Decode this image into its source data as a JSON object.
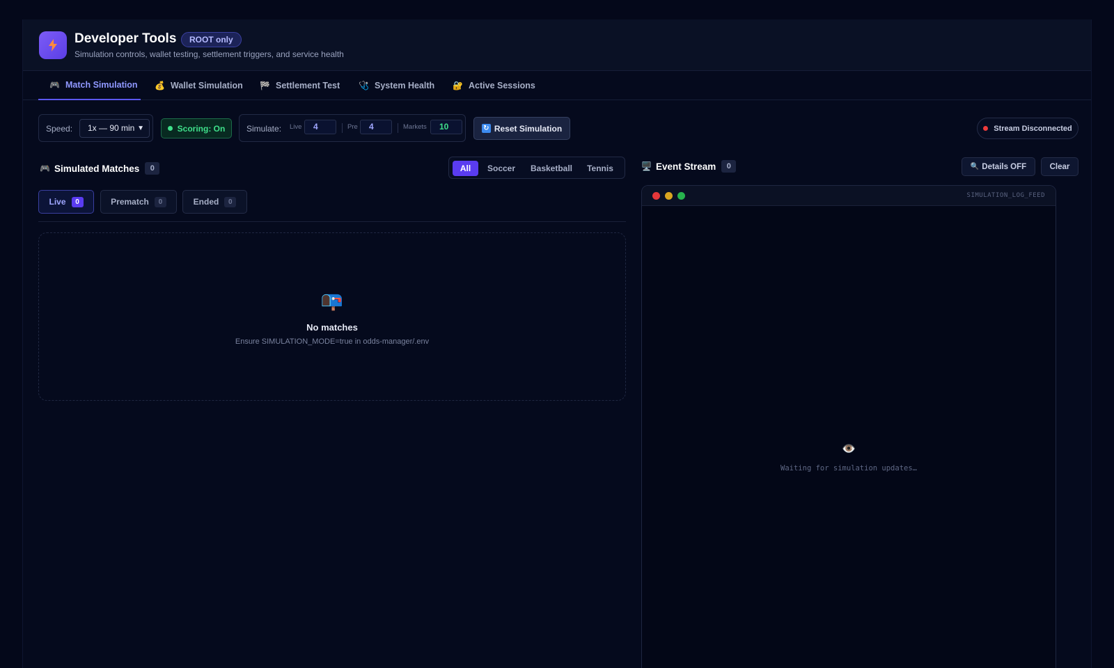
{
  "header": {
    "title": "Developer Tools",
    "badge": "ROOT only",
    "subtitle": "Simulation controls, wallet testing, settlement triggers, and service health"
  },
  "tabs": [
    {
      "label": "Match Simulation",
      "icon": "🎮"
    },
    {
      "label": "Wallet Simulation",
      "icon": "💰"
    },
    {
      "label": "Settlement Test",
      "icon": "🏁"
    },
    {
      "label": "System Health",
      "icon": "🩺"
    },
    {
      "label": "Active Sessions",
      "icon": "🔐"
    }
  ],
  "controls": {
    "speed_label": "Speed:",
    "speed_value": "1x — 90 min",
    "scoring": "Scoring: On",
    "simulate_label": "Simulate:",
    "live_label": "Live",
    "live_value": "4",
    "pre_label": "Pre",
    "pre_value": "4",
    "markets_label": "Markets",
    "markets_value": "10",
    "reset_label": "Reset Simulation",
    "stream_status": "Stream Disconnected"
  },
  "matches": {
    "title": "Simulated Matches",
    "count": "0",
    "sports": [
      "All",
      "Soccer",
      "Basketball",
      "Tennis"
    ],
    "status_tabs": [
      {
        "label": "Live",
        "count": "0"
      },
      {
        "label": "Prematch",
        "count": "0"
      },
      {
        "label": "Ended",
        "count": "0"
      }
    ],
    "empty_title": "No matches",
    "empty_subtitle": "Ensure SIMULATION_MODE=true in odds-manager/.env"
  },
  "stream": {
    "title": "Event Stream",
    "count": "0",
    "details_label": "Details OFF",
    "clear_label": "Clear",
    "terminal_label": "SIMULATION_LOG_FEED",
    "waiting": "Waiting for simulation updates…"
  },
  "colors": {
    "accent": "#5a3cf0",
    "success": "#3fe08b",
    "danger": "#ef3b3b",
    "background": "#04081a"
  }
}
